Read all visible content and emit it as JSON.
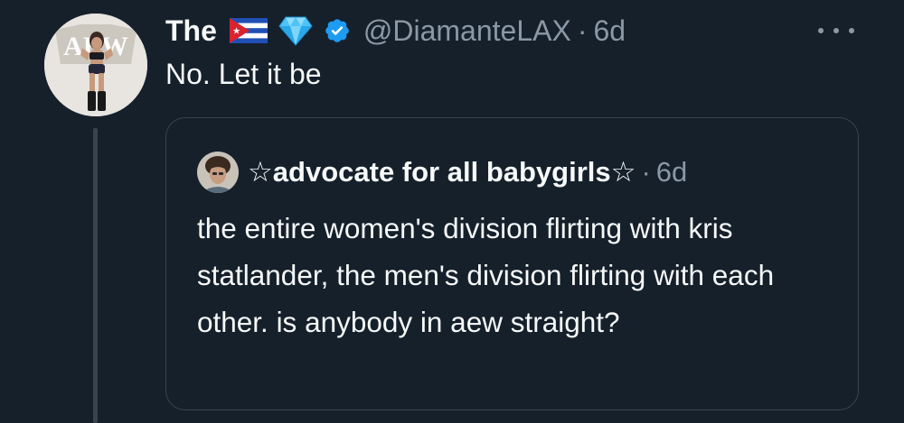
{
  "tweet": {
    "display_name": "The",
    "flag_icon": "cuba-flag-icon",
    "badge_icon": "gem-icon",
    "verified_icon": "verified-badge-icon",
    "verified_color": "#1d9bf0",
    "handle": "@DiamanteLAX",
    "separator": "·",
    "time": "6d",
    "more_icon": "more-options-icon",
    "text": "No. Let it be"
  },
  "quoted_tweet": {
    "display_name": "☆advocate for all babygirls☆",
    "separator": "·",
    "time": "6d",
    "text": "the entire women's division flirting with kris statlander, the men's division flirting with each other. is anybody in aew straight?"
  },
  "colors": {
    "background": "#15202b",
    "primary_text": "#f7f9f9",
    "secondary_text": "#8b98a5",
    "border": "#38444d"
  }
}
